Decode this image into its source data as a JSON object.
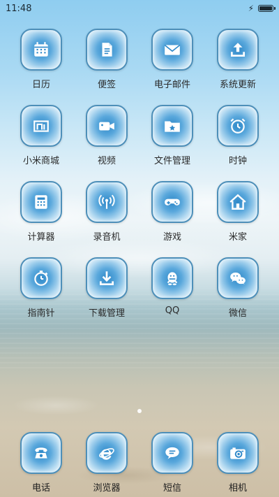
{
  "status_bar": {
    "time": "11:48",
    "battery_level": 1.0,
    "charging": true
  },
  "apps": [
    {
      "label": "日历",
      "icon": "calendar-icon"
    },
    {
      "label": "便签",
      "icon": "note-icon"
    },
    {
      "label": "电子邮件",
      "icon": "mail-icon"
    },
    {
      "label": "系统更新",
      "icon": "update-icon"
    },
    {
      "label": "小米商城",
      "icon": "store-icon"
    },
    {
      "label": "视频",
      "icon": "video-icon"
    },
    {
      "label": "文件管理",
      "icon": "folder-icon"
    },
    {
      "label": "时钟",
      "icon": "alarm-clock-icon"
    },
    {
      "label": "计算器",
      "icon": "calculator-icon"
    },
    {
      "label": "录音机",
      "icon": "recorder-icon"
    },
    {
      "label": "游戏",
      "icon": "gamepad-icon"
    },
    {
      "label": "米家",
      "icon": "home-icon"
    },
    {
      "label": "指南针",
      "icon": "stopwatch-icon"
    },
    {
      "label": "下载管理",
      "icon": "download-icon"
    },
    {
      "label": "QQ",
      "icon": "qq-penguin-icon"
    },
    {
      "label": "微信",
      "icon": "wechat-icon"
    }
  ],
  "dock": [
    {
      "label": "电话",
      "icon": "phone-icon"
    },
    {
      "label": "浏览器",
      "icon": "browser-icon"
    },
    {
      "label": "短信",
      "icon": "message-icon"
    },
    {
      "label": "相机",
      "icon": "camera-icon"
    }
  ],
  "pager": {
    "current_page": 1,
    "total_pages": 1
  }
}
